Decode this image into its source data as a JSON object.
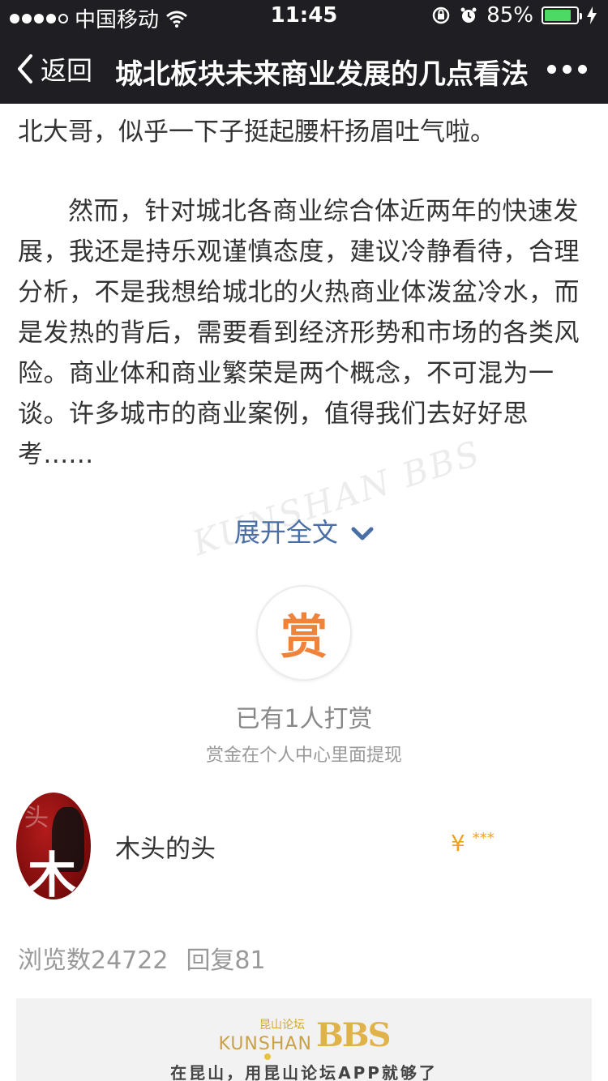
{
  "status_bar": {
    "carrier": "中国移动",
    "time": "11:45",
    "battery_percent": "85%",
    "battery_level": 0.85
  },
  "navbar": {
    "back_label": "返回",
    "title": "城北板块未来商业发展的几点看法"
  },
  "article": {
    "line_top": "北大哥，似乎一下子挺起腰杆扬眉吐气啦。",
    "paragraph": "然而，针对城北各商业综合体近两年的快速发展，我还是持乐观谨慎态度，建议冷静看待，合理分析，不是我想给城北的火热商业体泼盆冷水，而是发热的背后，需要看到经济形势和市场的各类风险。商业体和商业繁荣是两个概念，不可混为一谈。许多城市的商业案例，值得我们去好好思考......"
  },
  "expand": {
    "label": "展开全文"
  },
  "watermark": {
    "text": "KUNSHAN BBS"
  },
  "reward": {
    "button_char": "赏",
    "count_text": "已有1人打赏",
    "hint": "赏金在个人中心里面提现"
  },
  "rewarder": {
    "avatar_glyph": "木",
    "avatar_small_glyph": "头",
    "name": "木头的头",
    "currency": "¥",
    "amount_masked": "***"
  },
  "stats": {
    "views": "浏览数24722",
    "replies": "回复81"
  },
  "banner": {
    "brand_cn": "昆山论坛",
    "brand_en": "KUNSHAN",
    "brand_bbs": "BBS",
    "slogan": "在昆山，用昆山论坛APP就够了"
  },
  "colors": {
    "navbar_bg": "#1f1f23",
    "link_blue": "#4a6fa5",
    "reward_orange": "#f0833a",
    "amount_gold": "#f0a21a",
    "battery_green": "#4cd964"
  }
}
